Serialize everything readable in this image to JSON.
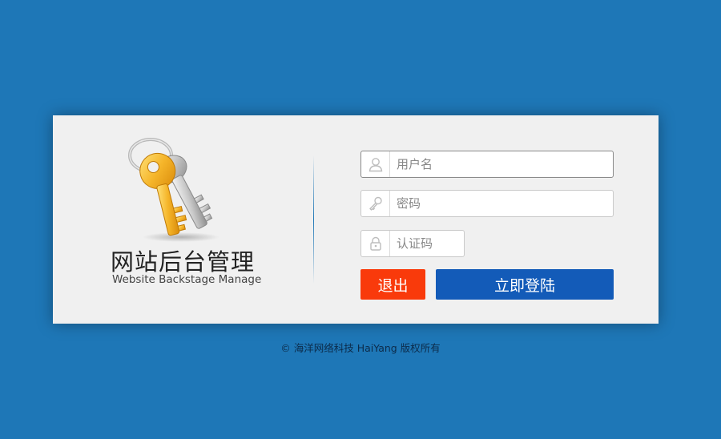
{
  "brand": {
    "title": "网站后台管理",
    "subtitle": "Website Backstage Manage"
  },
  "form": {
    "username": {
      "placeholder": "用户名",
      "value": "",
      "icon": "user-icon"
    },
    "password": {
      "placeholder": "密码",
      "value": "",
      "icon": "key-icon"
    },
    "captcha": {
      "placeholder": "认证码",
      "value": "",
      "icon": "lock-icon"
    }
  },
  "buttons": {
    "exit_label": "退出",
    "login_label": "立即登陆"
  },
  "footer": {
    "copyright": "© 海洋网络科技 HaiYang 版权所有"
  },
  "colors": {
    "background": "#1e77b7",
    "exit_button": "#f93a0b",
    "login_button": "#135bb8",
    "key_gold": "#f5b52a"
  }
}
